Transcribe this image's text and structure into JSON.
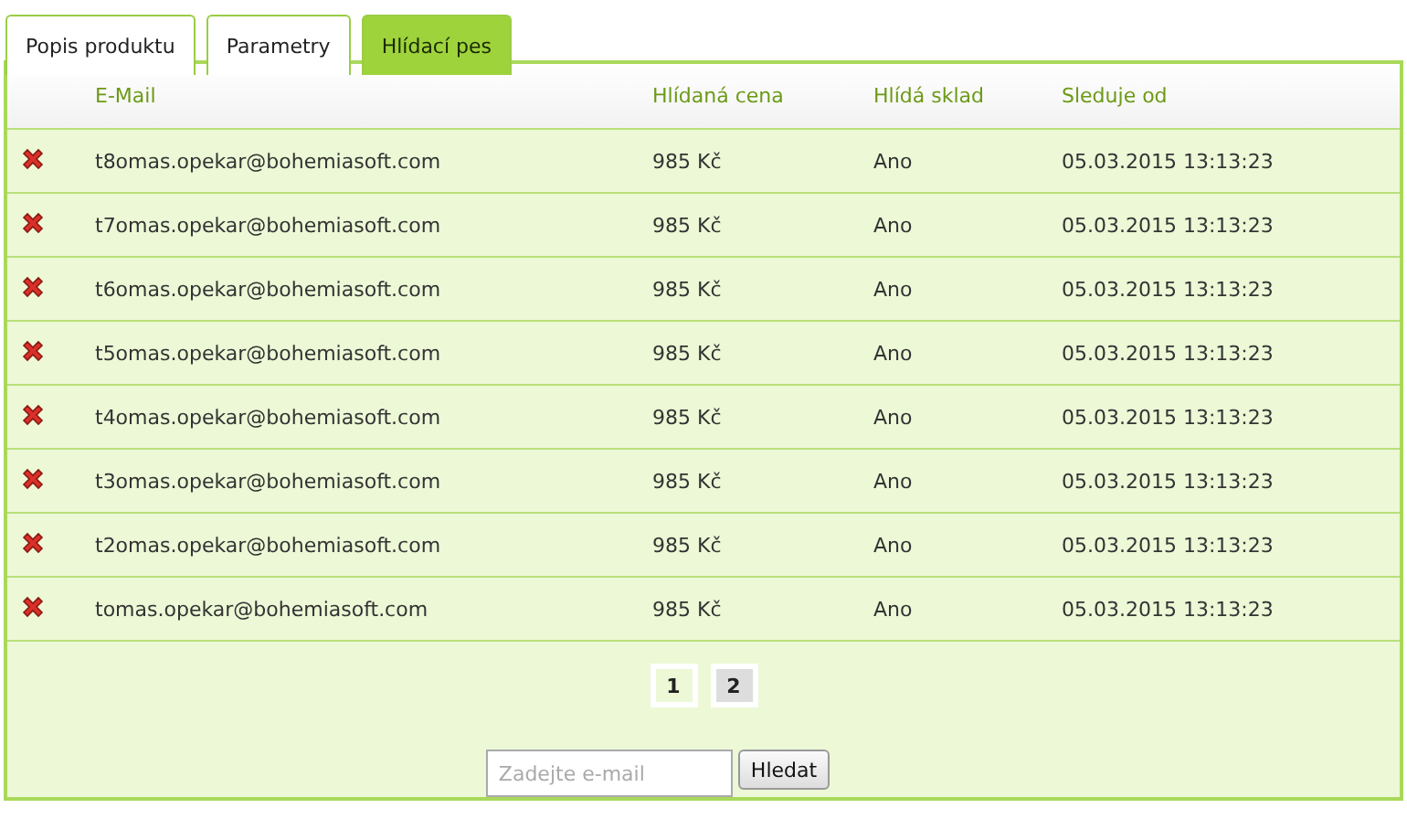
{
  "tabs": [
    {
      "label": "Popis produktu",
      "selected": false
    },
    {
      "label": "Parametry",
      "selected": false
    },
    {
      "label": "Hlídací pes",
      "selected": true
    }
  ],
  "table": {
    "columns": [
      "E-Mail",
      "Hlídaná cena",
      "Hlídá sklad",
      "Sleduje od"
    ],
    "rows": [
      {
        "email": "t8omas.opekar@bohemiasoft.com",
        "price": "985 Kč",
        "stock": "Ano",
        "since": "05.03.2015 13:13:23"
      },
      {
        "email": "t7omas.opekar@bohemiasoft.com",
        "price": "985 Kč",
        "stock": "Ano",
        "since": "05.03.2015 13:13:23"
      },
      {
        "email": "t6omas.opekar@bohemiasoft.com",
        "price": "985 Kč",
        "stock": "Ano",
        "since": "05.03.2015 13:13:23"
      },
      {
        "email": "t5omas.opekar@bohemiasoft.com",
        "price": "985 Kč",
        "stock": "Ano",
        "since": "05.03.2015 13:13:23"
      },
      {
        "email": "t4omas.opekar@bohemiasoft.com",
        "price": "985 Kč",
        "stock": "Ano",
        "since": "05.03.2015 13:13:23"
      },
      {
        "email": "t3omas.opekar@bohemiasoft.com",
        "price": "985 Kč",
        "stock": "Ano",
        "since": "05.03.2015 13:13:23"
      },
      {
        "email": "t2omas.opekar@bohemiasoft.com",
        "price": "985 Kč",
        "stock": "Ano",
        "since": "05.03.2015 13:13:23"
      },
      {
        "email": "tomas.opekar@bohemiasoft.com",
        "price": "985 Kč",
        "stock": "Ano",
        "since": "05.03.2015 13:13:23"
      }
    ]
  },
  "pagination": [
    {
      "label": "1",
      "selected": false
    },
    {
      "label": "2",
      "selected": true
    }
  ],
  "search": {
    "placeholder": "Zadejte e-mail",
    "button": "Hledat"
  }
}
